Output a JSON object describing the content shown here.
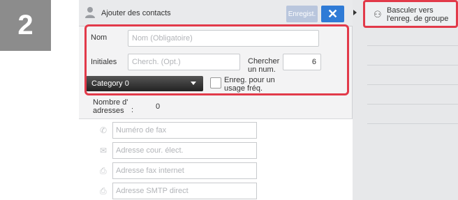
{
  "step": "2",
  "titlebar": {
    "title": "Ajouter des contacts",
    "save_label": "Enregist.",
    "close_label": "✕"
  },
  "form": {
    "name_label": "Nom",
    "name_placeholder": "Nom (Obligatoire)",
    "initials_label": "Initiales",
    "initials_placeholder": "Cherch. (Opt.)",
    "search_num_label": "Chercher un num.",
    "search_num_value": "6",
    "category_value": "Category 0",
    "frequent_label": "Enreg. pour un usage fréq."
  },
  "addresses": {
    "count_label": "Nombre d' adresses",
    "colon": ":",
    "count_value": "0",
    "items": [
      {
        "icon": "phone-icon",
        "placeholder": "Numéro de fax"
      },
      {
        "icon": "mail-icon",
        "placeholder": "Adresse cour. élect."
      },
      {
        "icon": "internet-fax-icon",
        "placeholder": "Adresse fax internet"
      },
      {
        "icon": "smtp-icon",
        "placeholder": "Adresse SMTP direct"
      }
    ]
  },
  "group_switch": {
    "label": "Basculer vers l'enreg. de groupe"
  },
  "colors": {
    "highlight": "#e23a4a",
    "close_button": "#2f7bd6",
    "save_button_disabled": "#b9c6dd"
  }
}
